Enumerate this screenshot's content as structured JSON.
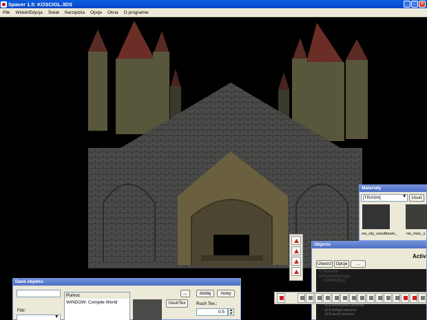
{
  "window": {
    "title": "Spacer 1.5: KOSCIOL.3DS"
  },
  "menu": [
    "Plik",
    "Widok/Edycja",
    "Świat",
    "Narzędzia",
    "Opcje",
    "Okna",
    "O programie"
  ],
  "materials": {
    "title": "Materiały",
    "filter_value": "[TRASH]",
    "delete_label": "Usuń",
    "textures": [
      "nw_city_woodbeam_",
      "nw_misc_s"
    ]
  },
  "objects": {
    "title": "Objects",
    "tabs": [
      "Utwórz",
      "Opcje",
      "..."
    ],
    "active_label": "Activ",
    "tree": [
      "zCMaterial",
      "zCEventMessage",
      "oCMobMsg",
      "",
      "",
      "",
      "",
      "",
      "zCEventMusicControler",
      "zCEvMsgCutscene",
      "zCEventCommon"
    ]
  },
  "props": {
    "title": "Dane objektu",
    "filter_label": "Filtr:",
    "help_title": "Pomoc",
    "help_text": "WINDOW: Compile World",
    "dots_label": "...",
    "add_label": "dodaj",
    "new_label": "nowy",
    "remove_tex_label": "UsuńTex",
    "move_tex_label": "Ruch Tex.:",
    "move_tex_value": "0.5"
  },
  "colors": {
    "titlebar": "#0a5fe0",
    "window_bg": "#ece9d8",
    "close": "#d9442a"
  }
}
